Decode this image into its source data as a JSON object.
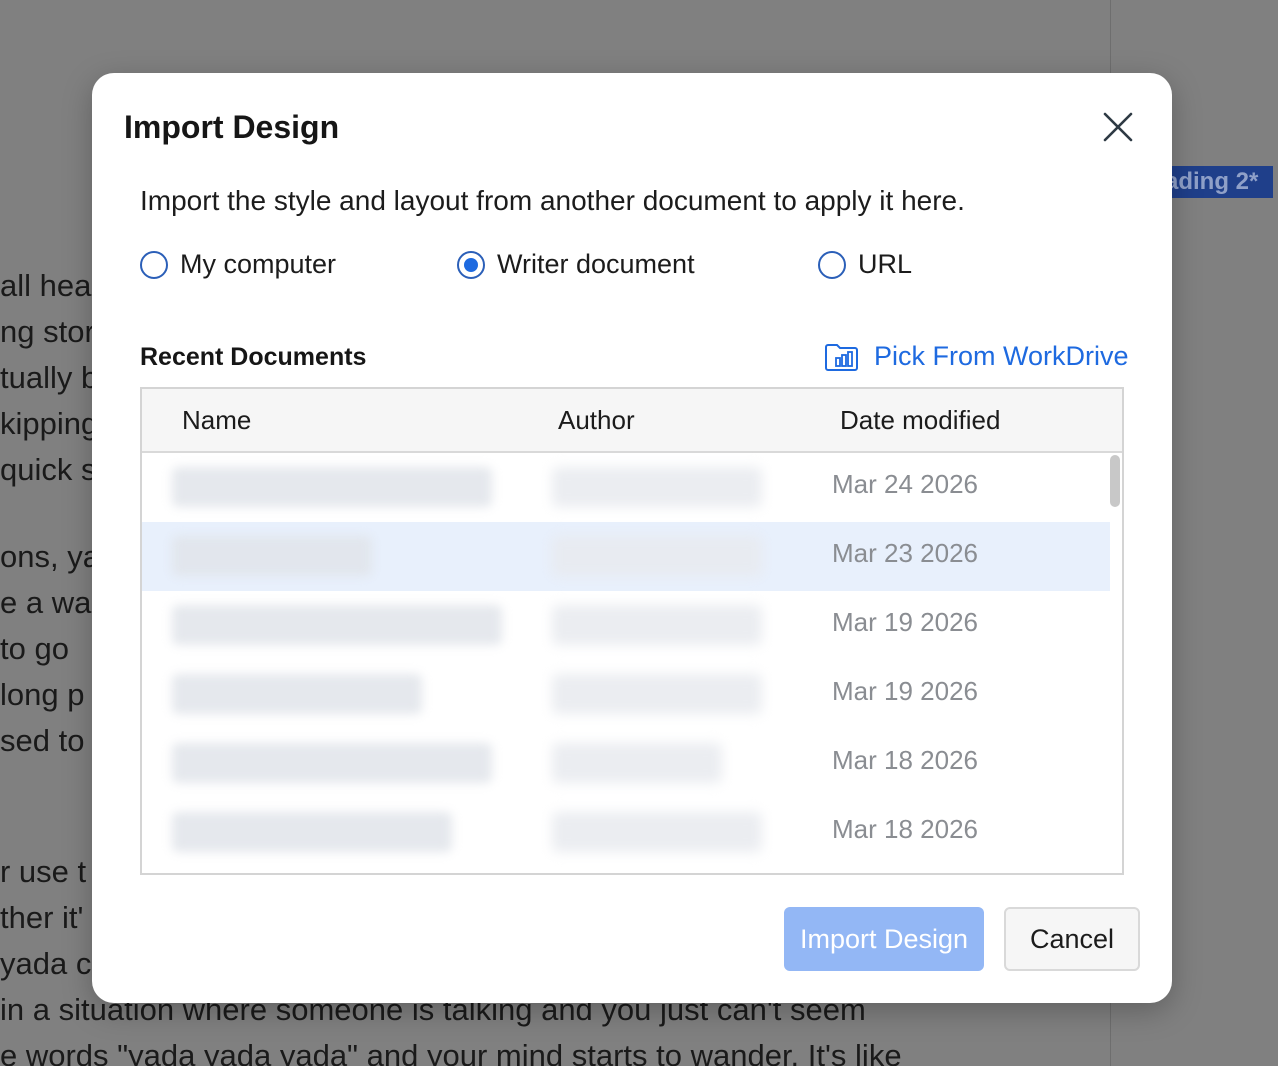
{
  "background": {
    "badge": "ading 2*",
    "lines": [
      "all hea",
      "ng stor",
      "tually b",
      "kipping",
      "quick s",
      "ons, yad",
      "e a wa",
      "to go",
      "long p",
      "sed to a",
      "r use t",
      "ther it'",
      "yada c",
      "in a situation where someone is talking and you just can't seem",
      "e words \"yada yada yada\" and your mind starts to wander. It's like"
    ]
  },
  "dialog": {
    "title": "Import Design",
    "description": "Import the style and layout from another document to apply it here.",
    "source_options": [
      {
        "label": "My computer",
        "checked": false
      },
      {
        "label": "Writer document",
        "checked": true
      },
      {
        "label": "URL",
        "checked": false
      }
    ],
    "recent_title": "Recent Documents",
    "pick_link": "Pick From WorkDrive",
    "table": {
      "headers": {
        "name": "Name",
        "author": "Author",
        "date": "Date modified"
      },
      "rows": [
        {
          "date": "Mar 24 2026",
          "selected": false
        },
        {
          "date": "Mar 23 2026",
          "selected": true
        },
        {
          "date": "Mar 19 2026",
          "selected": false
        },
        {
          "date": "Mar 19 2026",
          "selected": false
        },
        {
          "date": "Mar 18 2026",
          "selected": false
        },
        {
          "date": "Mar 18 2026",
          "selected": false
        }
      ]
    },
    "import_button": "Import Design",
    "cancel_button": "Cancel"
  },
  "colors": {
    "accent": "#1e6ae0",
    "primary_disabled": "#93b7f5",
    "selected_row": "#e8f0fc",
    "overlay": "#808080"
  }
}
